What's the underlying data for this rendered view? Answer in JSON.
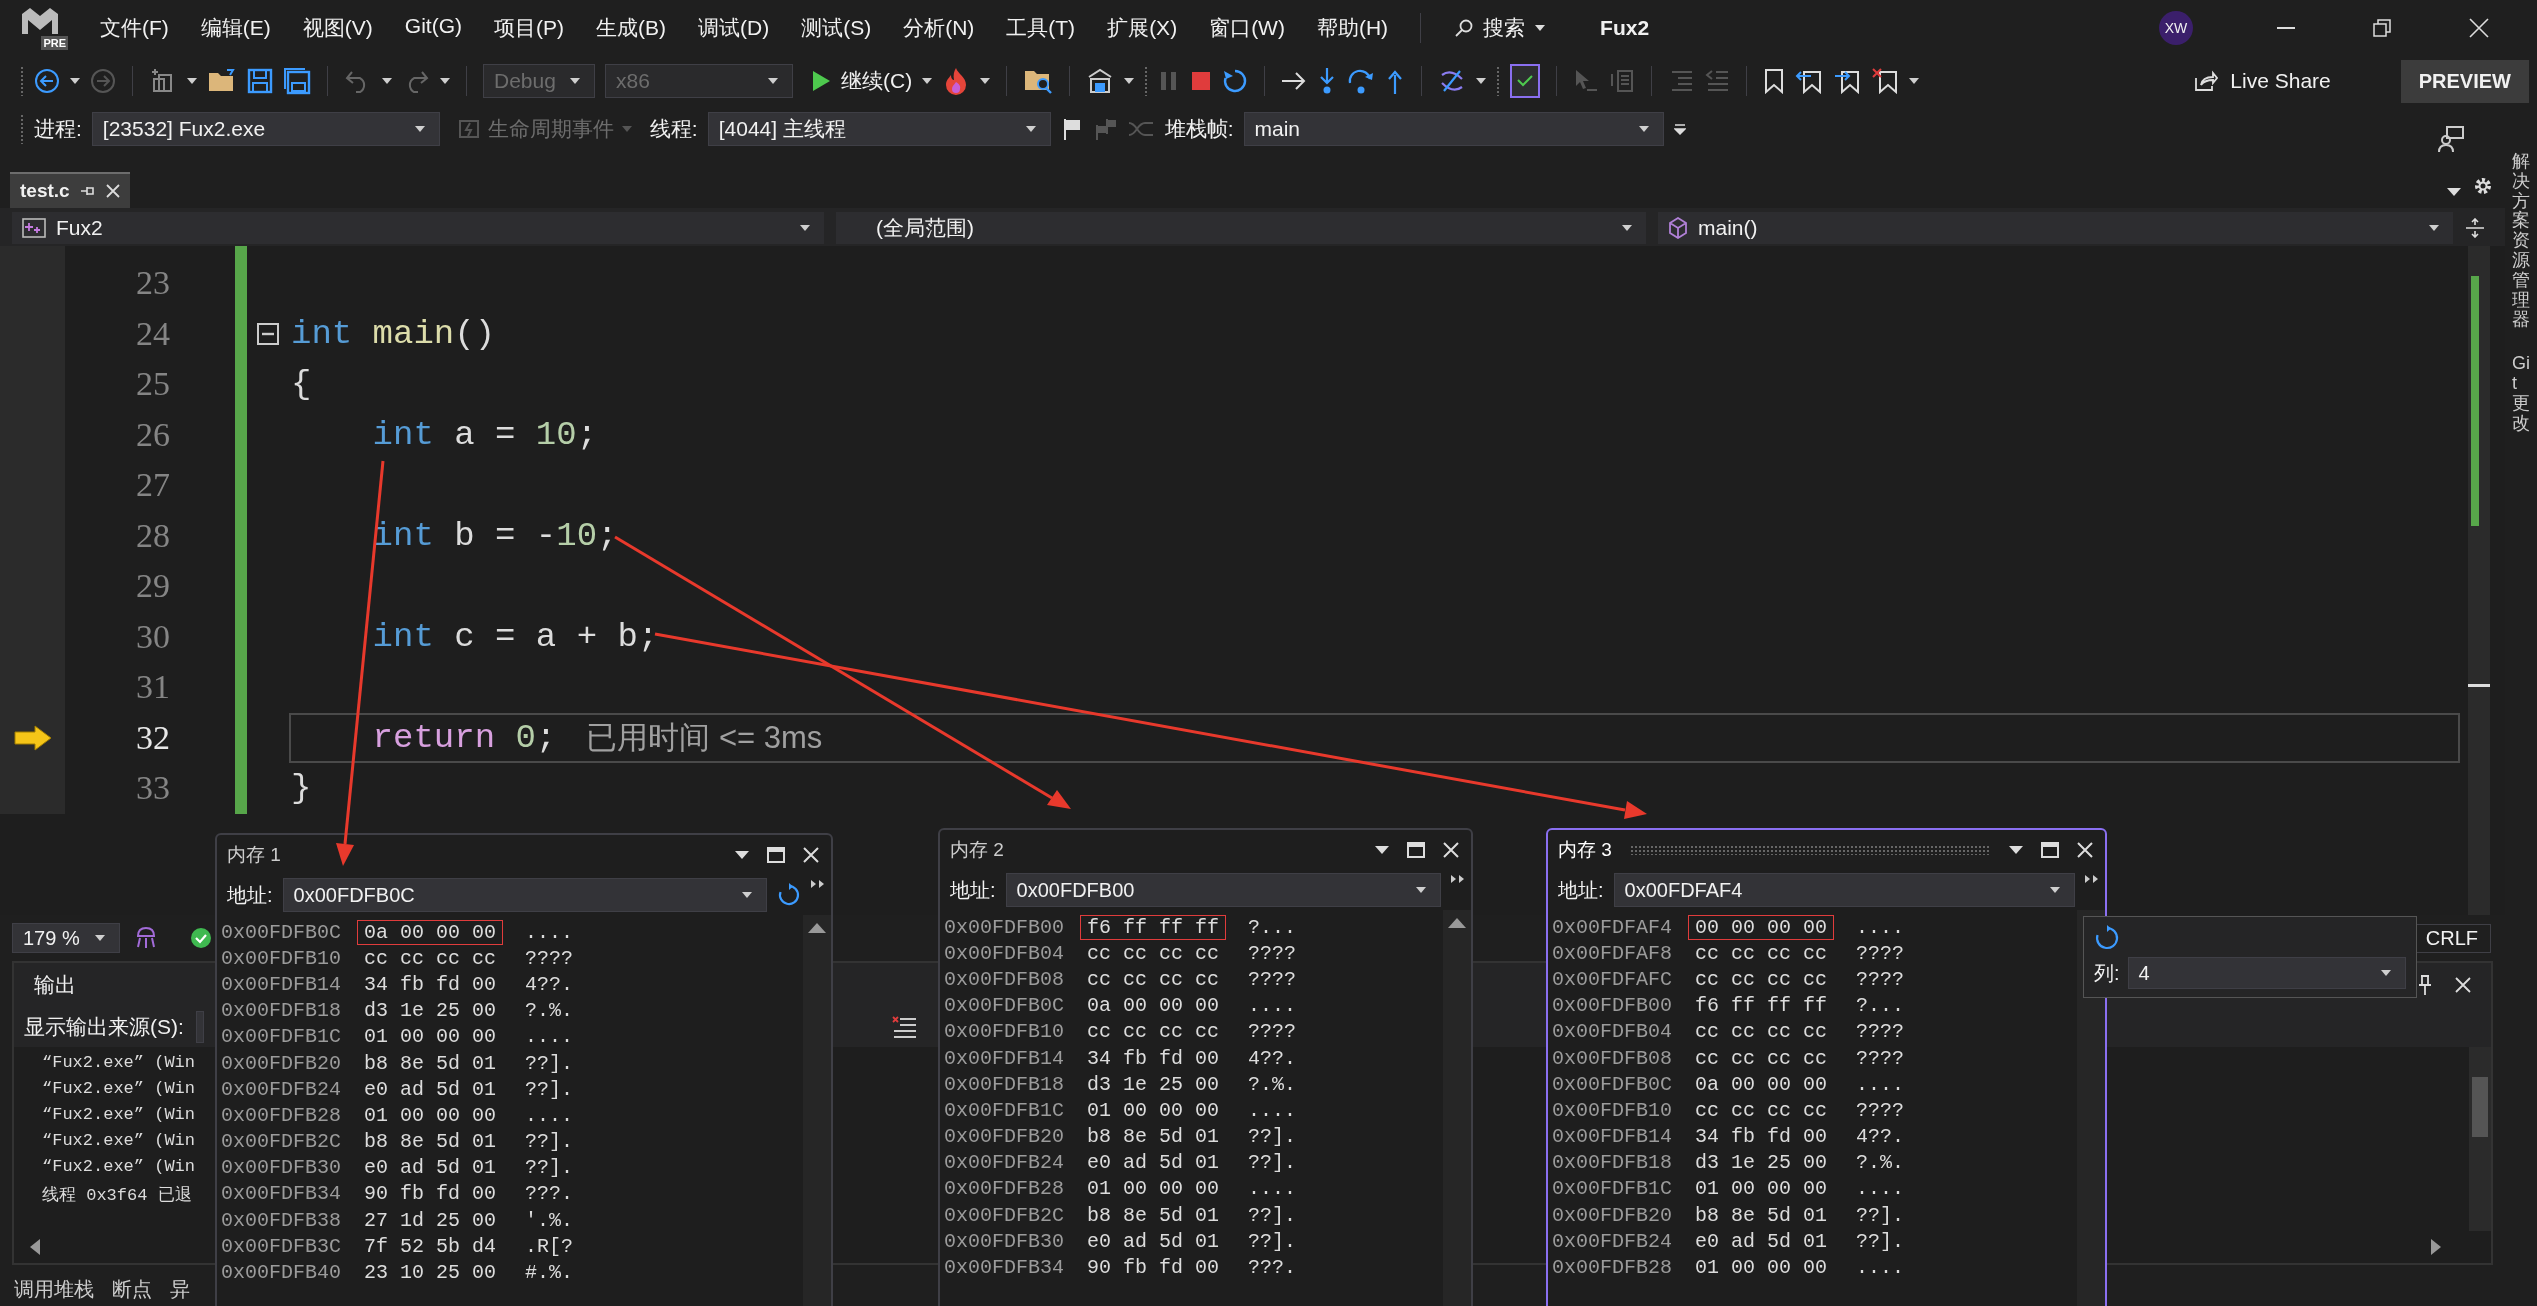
{
  "window": {
    "logo_badge": "PRE",
    "title": "Fux2",
    "user_initials": "XW"
  },
  "menu": [
    "文件(F)",
    "编辑(E)",
    "视图(V)",
    "Git(G)",
    "项目(P)",
    "生成(B)",
    "调试(D)",
    "测试(S)",
    "分析(N)",
    "工具(T)",
    "扩展(X)",
    "窗口(W)",
    "帮助(H)"
  ],
  "search": {
    "label": "搜索"
  },
  "toolbar": {
    "configuration": {
      "value": "Debug",
      "disabled": true
    },
    "platform": {
      "value": "x86",
      "disabled": true
    },
    "continue_label": "继续(C)",
    "live_share": "Live Share",
    "preview": "PREVIEW"
  },
  "debug_location": {
    "process_label": "进程:",
    "process": "[23532] Fux2.exe",
    "lifecycle": {
      "label": "生命周期事件",
      "disabled": true
    },
    "thread_label": "线程:",
    "thread": "[4044] 主线程",
    "stack_label": "堆栈帧:",
    "stack_frame": "main"
  },
  "tabs": [
    {
      "label": "test.c",
      "selected": true
    }
  ],
  "nav_bar": {
    "project": "Fux2",
    "scope": "(全局范围)",
    "member": "main()"
  },
  "editor": {
    "lines": [
      {
        "number": "23",
        "current": false,
        "foldable": false
      },
      {
        "number": "24",
        "current": false,
        "foldable": true,
        "tokens": [
          {
            "kind": "keyword",
            "text": "int"
          },
          {
            "kind": "function",
            "text": " main"
          },
          {
            "kind": "plain",
            "text": "()"
          }
        ]
      },
      {
        "number": "25",
        "current": false,
        "foldable": false,
        "tokens": [
          {
            "kind": "plain",
            "text": "{"
          }
        ]
      },
      {
        "number": "26",
        "current": false,
        "foldable": false,
        "tokens": [
          {
            "kind": "keyword",
            "text": "    int"
          },
          {
            "kind": "plain",
            "text": " a = "
          },
          {
            "kind": "number",
            "text": "10"
          },
          {
            "kind": "plain",
            "text": ";"
          }
        ]
      },
      {
        "number": "27",
        "current": false,
        "foldable": false
      },
      {
        "number": "28",
        "current": false,
        "foldable": false,
        "tokens": [
          {
            "kind": "keyword",
            "text": "    int"
          },
          {
            "kind": "plain",
            "text": " b = -"
          },
          {
            "kind": "number",
            "text": "10"
          },
          {
            "kind": "plain",
            "text": ";"
          }
        ]
      },
      {
        "number": "29",
        "current": false,
        "foldable": false
      },
      {
        "number": "30",
        "current": false,
        "foldable": false,
        "tokens": [
          {
            "kind": "keyword",
            "text": "    int"
          },
          {
            "kind": "plain",
            "text": " c = a + b;"
          }
        ]
      },
      {
        "number": "31",
        "current": false,
        "foldable": false
      },
      {
        "number": "32",
        "current": true,
        "foldable": false,
        "tokens": [
          {
            "kind": "control",
            "text": "    return"
          },
          {
            "kind": "number",
            "text": " 0"
          },
          {
            "kind": "plain",
            "text": ";"
          }
        ],
        "hint": "已用时间 <= 3ms"
      },
      {
        "number": "33",
        "current": false,
        "foldable": false,
        "tokens": [
          {
            "kind": "plain",
            "text": "}"
          }
        ]
      }
    ]
  },
  "status": {
    "zoom": "179 %",
    "line_ending": "CRLF"
  },
  "output": {
    "title": "输出",
    "source_label": "显示输出来源(S):",
    "lines": [
      "“Fux2.exe” (Win",
      "“Fux2.exe” (Win",
      "“Fux2.exe” (Win",
      "“Fux2.exe” (Win",
      "“Fux2.exe” (Win",
      "线程 0x3f64 已退"
    ]
  },
  "bottom_tabs": [
    "调用堆栈",
    "断点",
    "异"
  ],
  "side_tabs": [
    "解决方案资源管理器",
    "Git 更改"
  ],
  "memory_windows": [
    {
      "title": "内存 1",
      "active": false,
      "address_label": "地址:",
      "address": "0x00FDFB0C",
      "rows": [
        {
          "address": "0x00FDFB0C",
          "bytes": "0a 00 00 00",
          "text": "....",
          "boxed": true
        },
        {
          "address": "0x00FDFB10",
          "bytes": "cc cc cc cc",
          "text": "????",
          "boxed": false
        },
        {
          "address": "0x00FDFB14",
          "bytes": "34 fb fd 00",
          "text": "4??.",
          "boxed": false
        },
        {
          "address": "0x00FDFB18",
          "bytes": "d3 1e 25 00",
          "text": "?.%.",
          "boxed": false
        },
        {
          "address": "0x00FDFB1C",
          "bytes": "01 00 00 00",
          "text": "....",
          "boxed": false
        },
        {
          "address": "0x00FDFB20",
          "bytes": "b8 8e 5d 01",
          "text": "??].",
          "boxed": false
        },
        {
          "address": "0x00FDFB24",
          "bytes": "e0 ad 5d 01",
          "text": "??].",
          "boxed": false
        },
        {
          "address": "0x00FDFB28",
          "bytes": "01 00 00 00",
          "text": "....",
          "boxed": false
        },
        {
          "address": "0x00FDFB2C",
          "bytes": "b8 8e 5d 01",
          "text": "??].",
          "boxed": false
        },
        {
          "address": "0x00FDFB30",
          "bytes": "e0 ad 5d 01",
          "text": "??].",
          "boxed": false
        },
        {
          "address": "0x00FDFB34",
          "bytes": "90 fb fd 00",
          "text": "???.",
          "boxed": false
        },
        {
          "address": "0x00FDFB38",
          "bytes": "27 1d 25 00",
          "text": "'.%.",
          "boxed": false
        },
        {
          "address": "0x00FDFB3C",
          "bytes": "7f 52 5b d4",
          "text": ".R[?",
          "boxed": false
        },
        {
          "address": "0x00FDFB40",
          "bytes": "23 10 25 00",
          "text": "#.%.",
          "boxed": false
        }
      ]
    },
    {
      "title": "内存 2",
      "active": false,
      "address_label": "地址:",
      "address": "0x00FDFB00",
      "rows": [
        {
          "address": "0x00FDFB00",
          "bytes": "f6 ff ff ff",
          "text": "?...",
          "boxed": true
        },
        {
          "address": "0x00FDFB04",
          "bytes": "cc cc cc cc",
          "text": "????",
          "boxed": false
        },
        {
          "address": "0x00FDFB08",
          "bytes": "cc cc cc cc",
          "text": "????",
          "boxed": false
        },
        {
          "address": "0x00FDFB0C",
          "bytes": "0a 00 00 00",
          "text": "....",
          "boxed": false
        },
        {
          "address": "0x00FDFB10",
          "bytes": "cc cc cc cc",
          "text": "????",
          "boxed": false
        },
        {
          "address": "0x00FDFB14",
          "bytes": "34 fb fd 00",
          "text": "4??.",
          "boxed": false
        },
        {
          "address": "0x00FDFB18",
          "bytes": "d3 1e 25 00",
          "text": "?.%.",
          "boxed": false
        },
        {
          "address": "0x00FDFB1C",
          "bytes": "01 00 00 00",
          "text": "....",
          "boxed": false
        },
        {
          "address": "0x00FDFB20",
          "bytes": "b8 8e 5d 01",
          "text": "??].",
          "boxed": false
        },
        {
          "address": "0x00FDFB24",
          "bytes": "e0 ad 5d 01",
          "text": "??].",
          "boxed": false
        },
        {
          "address": "0x00FDFB28",
          "bytes": "01 00 00 00",
          "text": "....",
          "boxed": false
        },
        {
          "address": "0x00FDFB2C",
          "bytes": "b8 8e 5d 01",
          "text": "??].",
          "boxed": false
        },
        {
          "address": "0x00FDFB30",
          "bytes": "e0 ad 5d 01",
          "text": "??].",
          "boxed": false
        },
        {
          "address": "0x00FDFB34",
          "bytes": "90 fb fd 00",
          "text": "???.",
          "boxed": false
        }
      ]
    },
    {
      "title": "内存 3",
      "active": true,
      "address_label": "地址:",
      "address": "0x00FDFAF4",
      "rows": [
        {
          "address": "0x00FDFAF4",
          "bytes": "00 00 00 00",
          "text": "....",
          "boxed": true
        },
        {
          "address": "0x00FDFAF8",
          "bytes": "cc cc cc cc",
          "text": "????",
          "boxed": false
        },
        {
          "address": "0x00FDFAFC",
          "bytes": "cc cc cc cc",
          "text": "????",
          "boxed": false
        },
        {
          "address": "0x00FDFB00",
          "bytes": "f6 ff ff ff",
          "text": "?...",
          "boxed": false
        },
        {
          "address": "0x00FDFB04",
          "bytes": "cc cc cc cc",
          "text": "????",
          "boxed": false
        },
        {
          "address": "0x00FDFB08",
          "bytes": "cc cc cc cc",
          "text": "????",
          "boxed": false
        },
        {
          "address": "0x00FDFB0C",
          "bytes": "0a 00 00 00",
          "text": "....",
          "boxed": false
        },
        {
          "address": "0x00FDFB10",
          "bytes": "cc cc cc cc",
          "text": "????",
          "boxed": false
        },
        {
          "address": "0x00FDFB14",
          "bytes": "34 fb fd 00",
          "text": "4??.",
          "boxed": false
        },
        {
          "address": "0x00FDFB18",
          "bytes": "d3 1e 25 00",
          "text": "?.%.",
          "boxed": false
        },
        {
          "address": "0x00FDFB1C",
          "bytes": "01 00 00 00",
          "text": "....",
          "boxed": false
        },
        {
          "address": "0x00FDFB20",
          "bytes": "b8 8e 5d 01",
          "text": "??].",
          "boxed": false
        },
        {
          "address": "0x00FDFB24",
          "bytes": "e0 ad 5d 01",
          "text": "??].",
          "boxed": false
        },
        {
          "address": "0x00FDFB28",
          "bytes": "01 00 00 00",
          "text": "....",
          "boxed": false
        }
      ]
    }
  ],
  "columns_popup": {
    "label": "列:",
    "value": "4"
  }
}
